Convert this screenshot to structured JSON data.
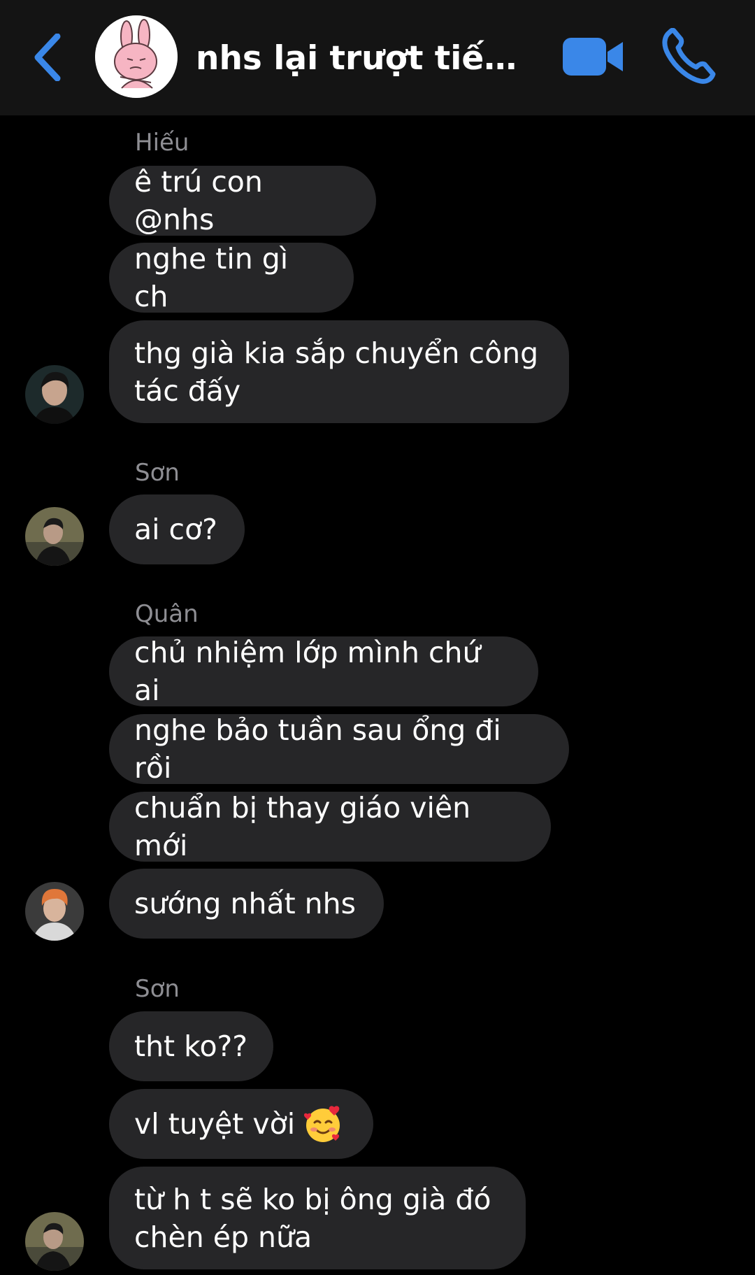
{
  "header": {
    "title": "nhs lại trượt tiếng ...",
    "icons": {
      "back": "chevron-left-icon",
      "video": "video-camera-icon",
      "call": "phone-icon"
    },
    "accent_color": "#3a87e8"
  },
  "groups": [
    {
      "sender": "Hiếu",
      "messages": [
        "ê trú con @nhs",
        "nghe tin gì ch",
        "thg già kia sắp chuyển công tác đấy"
      ]
    },
    {
      "sender": "Sơn",
      "messages": [
        "ai cơ?"
      ]
    },
    {
      "sender": "Quân",
      "messages": [
        "chủ nhiệm lớp mình chứ ai",
        "nghe bảo tuần sau ổng đi rồi",
        "chuẩn bị thay giáo viên mới",
        "sướng nhất nhs"
      ]
    },
    {
      "sender": "Sơn",
      "messages": [
        "tht ko??",
        "vl tuyệt vời",
        "từ h t sẽ ko bị ông già đó chèn ép nữa"
      ]
    }
  ],
  "emoji": "smiling-face-with-hearts-icon"
}
